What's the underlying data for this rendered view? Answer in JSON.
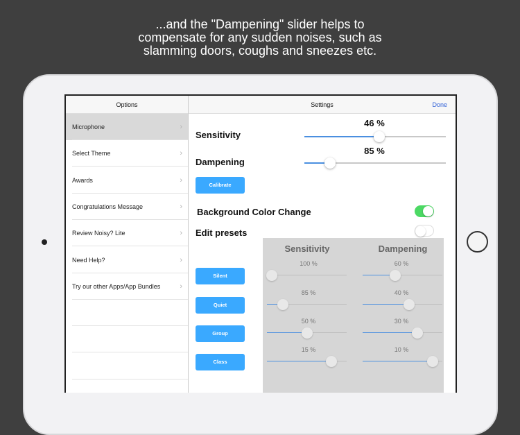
{
  "caption": {
    "lines": [
      "...and the \"Dampening\" slider helps to",
      "compensate for any sudden noises, such as",
      "slamming doors, coughs and sneezes etc."
    ]
  },
  "options": {
    "title": "Options",
    "items": [
      {
        "label": "Microphone",
        "selected": true
      },
      {
        "label": "Select Theme"
      },
      {
        "label": "Awards"
      },
      {
        "label": "Congratulations Message"
      },
      {
        "label": "Review Noisy? Lite"
      },
      {
        "label": "Need Help?"
      },
      {
        "label": "Try our other Apps/App Bundles"
      }
    ]
  },
  "settings": {
    "title": "Settings",
    "done_label": "Done",
    "sensitivity": {
      "label": "Sensitivity",
      "value_text": "46 %",
      "slider_fraction": 0.53
    },
    "dampening": {
      "label": "Dampening",
      "value_text": "85 %",
      "slider_fraction": 0.18
    },
    "calibrate_label": "Calibrate",
    "background_color_change": {
      "label": "Background Color Change",
      "on": true
    },
    "edit_presets": {
      "label": "Edit presets",
      "on": false
    },
    "presets": {
      "sensitivity_header": "Sensitivity",
      "dampening_header": "Dampening",
      "rows": [
        {
          "name": "Silent",
          "sensitivity": "100 %",
          "sens_fraction": 0.06,
          "dampening": "60 %",
          "damp_fraction": 0.41
        },
        {
          "name": "Quiet",
          "sensitivity": "85 %",
          "sens_fraction": 0.2,
          "dampening": "40 %",
          "damp_fraction": 0.58
        },
        {
          "name": "Group",
          "sensitivity": "50 %",
          "sens_fraction": 0.5,
          "dampening": "30 %",
          "damp_fraction": 0.69
        },
        {
          "name": "Class",
          "sensitivity": "15 %",
          "sens_fraction": 0.81,
          "dampening": "10 %",
          "damp_fraction": 0.88
        }
      ]
    }
  },
  "colors": {
    "accent": "#3aa9ff",
    "toggle_on": "#4cd964",
    "link": "#2e5fd6"
  }
}
